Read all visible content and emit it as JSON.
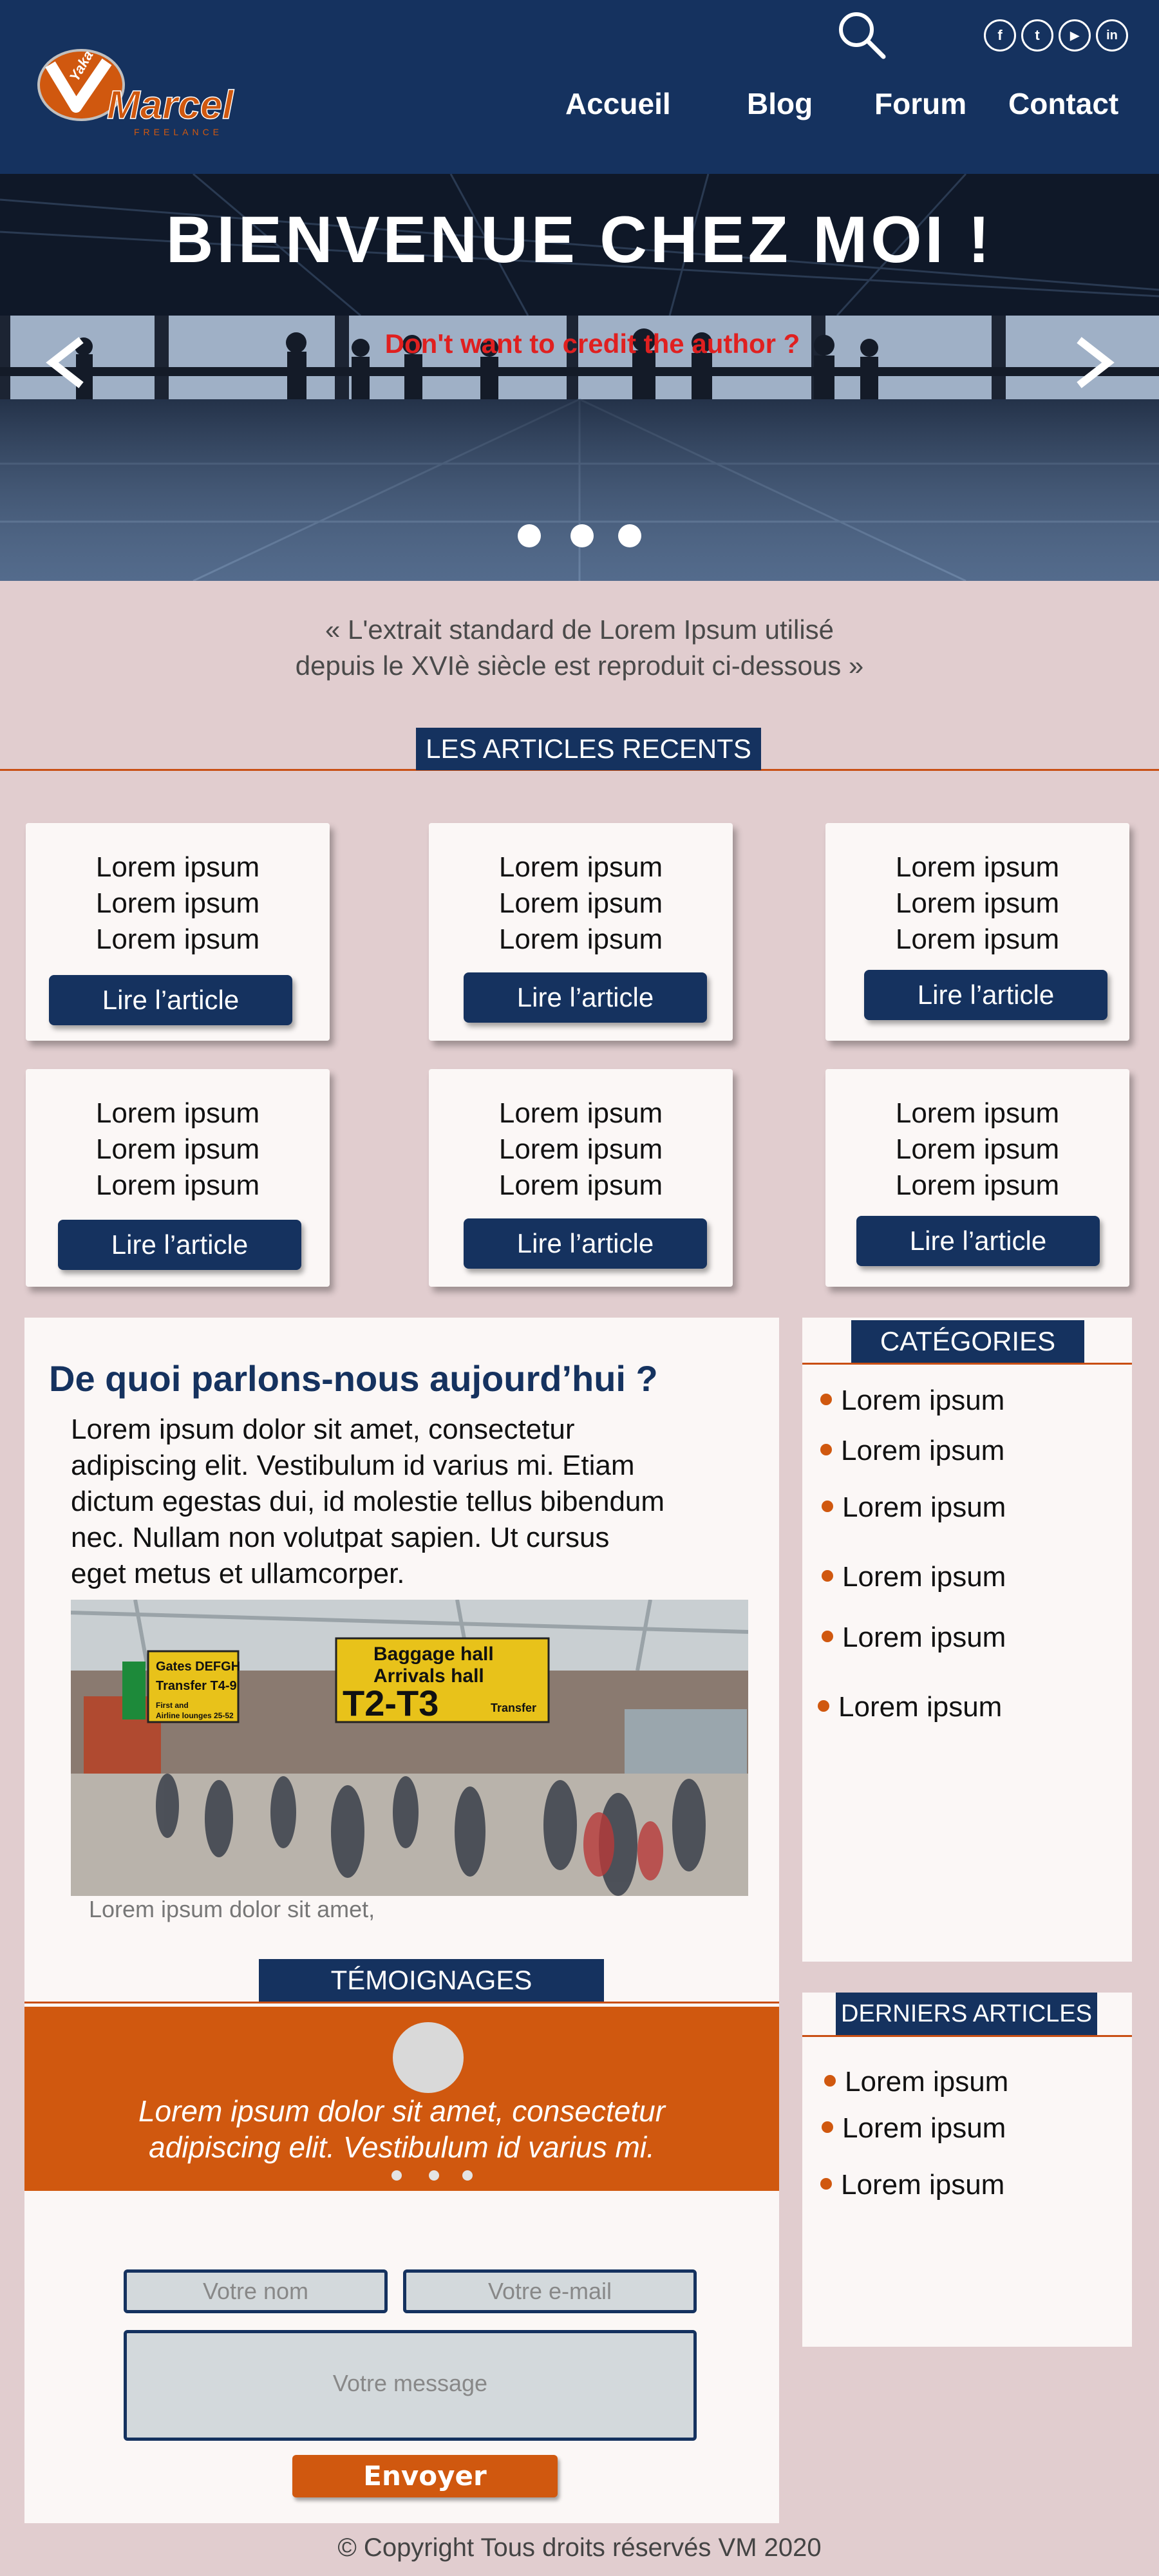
{
  "brand": {
    "logo_top": "Yaka",
    "logo_main": "Marcel",
    "logo_sub": "FREELANCE"
  },
  "nav": [
    {
      "label": "Accueil"
    },
    {
      "label": "Blog"
    },
    {
      "label": "Forum"
    },
    {
      "label": "Contact"
    }
  ],
  "social": [
    {
      "label": "f",
      "icon": "facebook-icon"
    },
    {
      "label": "t",
      "icon": "twitter-icon"
    },
    {
      "label": "▶",
      "icon": "youtube-icon"
    },
    {
      "label": "in",
      "icon": "linkedin-icon"
    }
  ],
  "hero": {
    "title": "BIENVENUE CHEZ MOI !",
    "credit": "Don't want to credit the author ?",
    "prev": "<",
    "next": ">"
  },
  "intro": {
    "line1": "« L'extrait standard de Lorem Ipsum utilisé",
    "line2": "depuis le XVIè siècle est reproduit ci-dessous »"
  },
  "recent": {
    "heading": "LES ARTICLES RECENTS",
    "cards": [
      {
        "lines": [
          "Lorem ipsum",
          "Lorem ipsum",
          "Lorem ipsum"
        ],
        "button": "Lire l’article"
      },
      {
        "lines": [
          "Lorem ipsum",
          "Lorem ipsum",
          "Lorem ipsum"
        ],
        "button": "Lire l’article"
      },
      {
        "lines": [
          "Lorem ipsum",
          "Lorem ipsum",
          "Lorem ipsum"
        ],
        "button": "Lire l’article"
      },
      {
        "lines": [
          "Lorem ipsum",
          "Lorem ipsum",
          "Lorem ipsum"
        ],
        "button": "Lire l’article"
      },
      {
        "lines": [
          "Lorem ipsum",
          "Lorem ipsum",
          "Lorem ipsum"
        ],
        "button": "Lire l’article"
      },
      {
        "lines": [
          "Lorem ipsum",
          "Lorem ipsum",
          "Lorem ipsum"
        ],
        "button": "Lire l’article"
      }
    ]
  },
  "main": {
    "title": "De quoi parlons-nous aujourd’hui ?",
    "body": [
      "Lorem ipsum dolor sit amet, consectetur",
      "adipiscing elit. Vestibulum id varius mi. Etiam",
      "dictum egestas dui, id molestie tellus bibendum",
      "nec. Nullam non volutpat sapien. Ut cursus",
      "eget metus et ullamcorper."
    ],
    "photo_signs": {
      "gates": "Gates DEFGH",
      "transfer": "Transfer T4-9",
      "baggage": "Baggage hall",
      "arrivals": "Arrivals hall",
      "terminal": "T2-T3",
      "transfer2": "Transfer",
      "first": "First and",
      "airline": "Airline lounges 25-52"
    },
    "caption": "Lorem ipsum dolor sit amet,"
  },
  "testimonials": {
    "heading": "TÉMOIGNAGES",
    "quote1": "Lorem ipsum dolor sit amet, consectetur",
    "quote2": "adipiscing elit. Vestibulum id varius mi."
  },
  "form": {
    "name_placeholder": "Votre nom",
    "email_placeholder": "Votre e-mail",
    "message_placeholder": "Votre message",
    "submit": "Envoyer"
  },
  "categories": {
    "heading": "CATÉGORIES",
    "items": [
      "Lorem ipsum",
      "Lorem ipsum",
      "Lorem ipsum",
      "Lorem ipsum",
      "Lorem ipsum",
      "Lorem ipsum"
    ]
  },
  "latest": {
    "heading": "DERNIERS ARTICLES",
    "items": [
      "Lorem ipsum",
      "Lorem ipsum",
      "Lorem ipsum"
    ]
  },
  "footer": {
    "copyright": "© Copyright Tous droits réservés VM 2020"
  },
  "colors": {
    "navy": "#15325f",
    "orange": "#d0580f",
    "background": "#e1cdcf",
    "card": "#fbf7f6",
    "credit_red": "#e02020"
  }
}
